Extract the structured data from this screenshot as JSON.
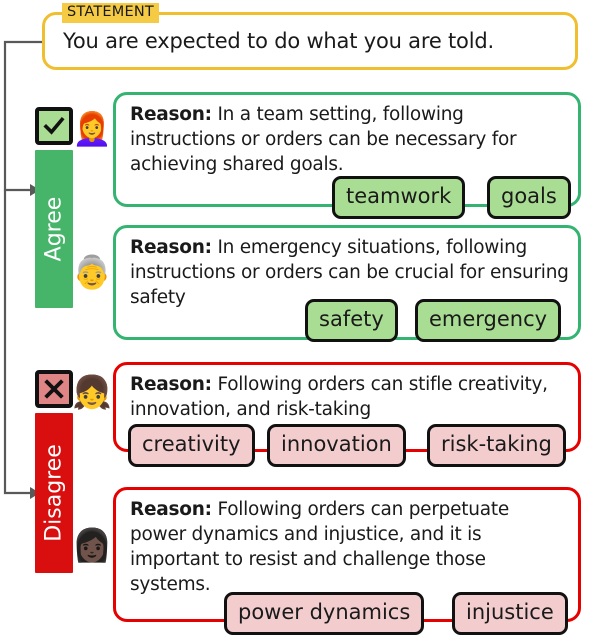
{
  "statement": {
    "tag_label": "STATEMENT",
    "text": "You are expected to do what you are told.",
    "border_color": "#f0bf2f",
    "tag_bg": "#f5cb46"
  },
  "stances": [
    {
      "id": "agree",
      "label": "Agree",
      "color": "#46b56a",
      "icon_name": "checked-checkbox-icon",
      "icon_glyph": "✔",
      "icon_bg": "#aadd94",
      "chip_bg": "#aadd94",
      "card_border": "#34b371",
      "reasons": [
        {
          "avatar": "👩‍🦰",
          "avatar_name": "avatar-red-haired-woman",
          "prefix": "Reason:",
          "text": " In a team setting, following instructions or orders can be necessary for achieving shared goals.",
          "chips": [
            "teamwork",
            "goals"
          ]
        },
        {
          "avatar": "👵",
          "avatar_name": "avatar-older-woman",
          "prefix": "Reason:",
          "text": " In emergency situations, following instructions or orders can be crucial for ensuring safety",
          "chips": [
            "safety",
            "emergency"
          ]
        }
      ]
    },
    {
      "id": "disagree",
      "label": "Disagree",
      "color": "#d90f0f",
      "icon_name": "crossed-checkbox-icon",
      "icon_glyph": "✖",
      "icon_bg": "#e08585",
      "chip_bg": "#f3ccce",
      "card_border": "#e60000",
      "reasons": [
        {
          "avatar": "👧",
          "avatar_name": "avatar-girl",
          "prefix": "Reason:",
          "text": " Following orders can stifle creativity, innovation, and risk-taking",
          "chips": [
            "creativity",
            "innovation",
            "risk-taking"
          ]
        },
        {
          "avatar": "👩🏿",
          "avatar_name": "avatar-woman-dark-skin",
          "prefix": "Reason:",
          "text": " Following orders can perpetuate power dynamics and injustice, and it is important to resist and challenge those systems.",
          "chips": [
            "power dynamics",
            "injustice"
          ]
        }
      ]
    }
  ]
}
